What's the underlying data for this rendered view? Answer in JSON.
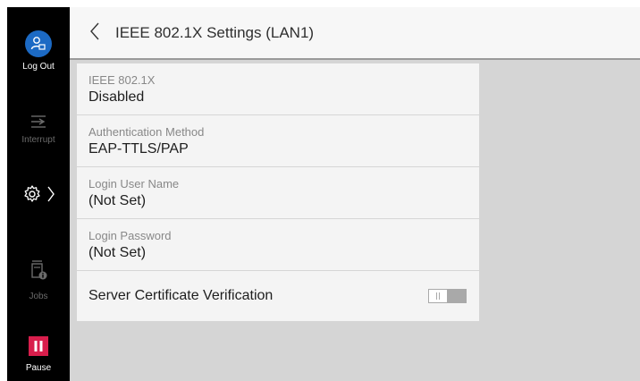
{
  "sidebar": {
    "logout": {
      "label": "Log Out",
      "icon": "logout-user-icon",
      "color": "#1c6ac4"
    },
    "interrupt": {
      "label": "Interrupt",
      "icon": "interrupt-icon"
    },
    "settings": {
      "icon": "gear-icon",
      "chevron": "chevron-right-icon"
    },
    "jobs": {
      "label": "Jobs",
      "icon": "jobs-icon"
    },
    "pause": {
      "label": "Pause",
      "icon": "pause-icon",
      "color": "#d81e4c"
    }
  },
  "header": {
    "back_icon": "chevron-left-icon",
    "title": "IEEE 802.1X Settings (LAN1)"
  },
  "settings": [
    {
      "label": "IEEE 802.1X",
      "value": "Disabled"
    },
    {
      "label": "Authentication Method",
      "value": "EAP-TTLS/PAP"
    },
    {
      "label": "Login User Name",
      "value": "(Not Set)"
    },
    {
      "label": "Login Password",
      "value": "(Not Set)"
    }
  ],
  "server_cert": {
    "label": "Server Certificate Verification",
    "toggle_state": "off"
  }
}
